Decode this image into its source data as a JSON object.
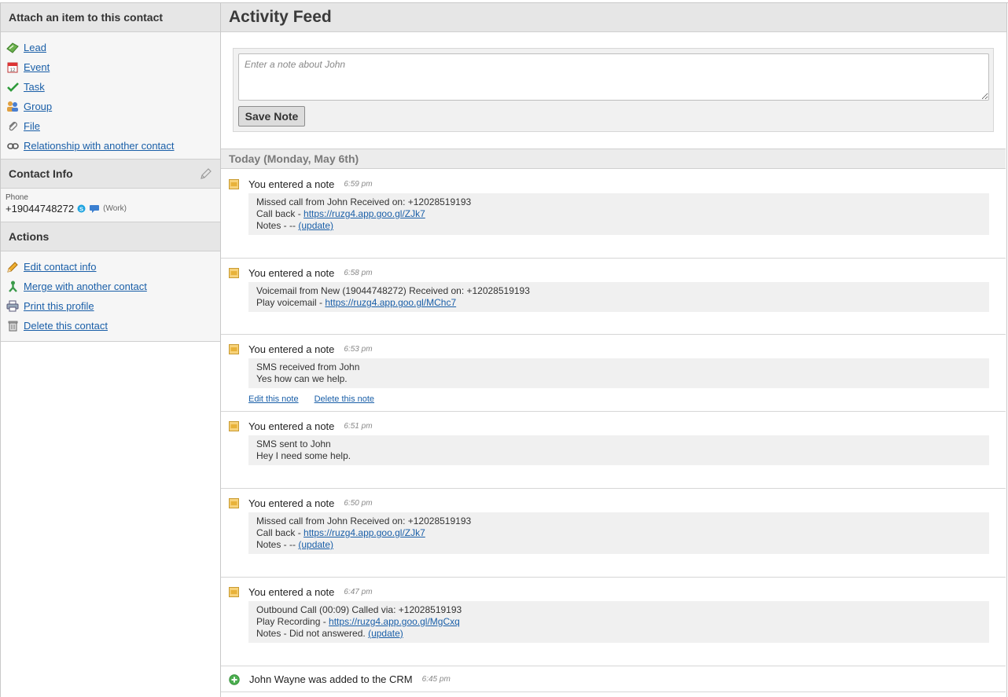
{
  "sidebar": {
    "attach": {
      "title": "Attach an item to this contact",
      "items": [
        {
          "label": "Lead",
          "icon": "lead-icon"
        },
        {
          "label": "Event",
          "icon": "calendar-icon"
        },
        {
          "label": "Task",
          "icon": "checkmark-icon"
        },
        {
          "label": "Group",
          "icon": "group-icon"
        },
        {
          "label": "File",
          "icon": "paperclip-icon"
        },
        {
          "label": "Relationship with another contact",
          "icon": "link-icon"
        }
      ]
    },
    "contact_info": {
      "title": "Contact Info",
      "phone_label": "Phone",
      "phone": "+19044748272",
      "phone_type": "(Work)"
    },
    "actions": {
      "title": "Actions",
      "items": [
        {
          "label": "Edit contact info",
          "icon": "pencil-icon"
        },
        {
          "label": "Merge with another contact",
          "icon": "merge-icon"
        },
        {
          "label": "Print this profile",
          "icon": "printer-icon"
        },
        {
          "label": "Delete this contact",
          "icon": "trash-icon"
        }
      ]
    }
  },
  "main": {
    "title": "Activity Feed",
    "note_placeholder": "Enter a note about John",
    "save_label": "Save Note",
    "day_label": "Today (Monday, May 6th)",
    "entries": [
      {
        "who": "You entered a note",
        "time": "6:59 pm",
        "lines": [
          {
            "text": "Missed call from John Received on: +12028519193",
            "link": ""
          },
          {
            "text": "Call back - ",
            "link": "https://ruzg4.app.goo.gl/ZJk7"
          },
          {
            "text": "Notes - -- ",
            "link": "(update)"
          }
        ]
      },
      {
        "who": "You entered a note",
        "time": "6:58 pm",
        "lines": [
          {
            "text": "Voicemail from New (19044748272) Received on: +12028519193",
            "link": ""
          },
          {
            "text": "Play voicemail - ",
            "link": "https://ruzg4.app.goo.gl/MChc7"
          }
        ]
      },
      {
        "who": "You entered a note",
        "time": "6:53 pm",
        "lines": [
          {
            "text": "SMS received from John",
            "link": ""
          },
          {
            "text": "Yes how can we help.",
            "link": ""
          }
        ],
        "actions": [
          "Edit this note",
          "Delete this note"
        ]
      },
      {
        "who": "You entered a note",
        "time": "6:51 pm",
        "lines": [
          {
            "text": "SMS sent to John",
            "link": ""
          },
          {
            "text": "Hey I need some help.",
            "link": ""
          }
        ]
      },
      {
        "who": "You entered a note",
        "time": "6:50 pm",
        "lines": [
          {
            "text": "Missed call from John Received on: +12028519193",
            "link": ""
          },
          {
            "text": "Call back - ",
            "link": "https://ruzg4.app.goo.gl/ZJk7"
          },
          {
            "text": "Notes - -- ",
            "link": "(update)"
          }
        ]
      },
      {
        "who": "You entered a note",
        "time": "6:47 pm",
        "lines": [
          {
            "text": "Outbound Call (00:09) Called via: +12028519193",
            "link": ""
          },
          {
            "text": "Play Recording - ",
            "link": "https://ruzg4.app.goo.gl/MgCxq"
          },
          {
            "text": "Notes - Did not answered. ",
            "link": "(update)"
          }
        ]
      }
    ],
    "added": {
      "text": "John Wayne was added to the CRM",
      "time": "6:45 pm"
    }
  },
  "colors": {
    "link": "#1a5fa8",
    "header_bg": "#e6e6e6",
    "note_icon": "#e8b23a",
    "add_icon": "#4caf50"
  }
}
